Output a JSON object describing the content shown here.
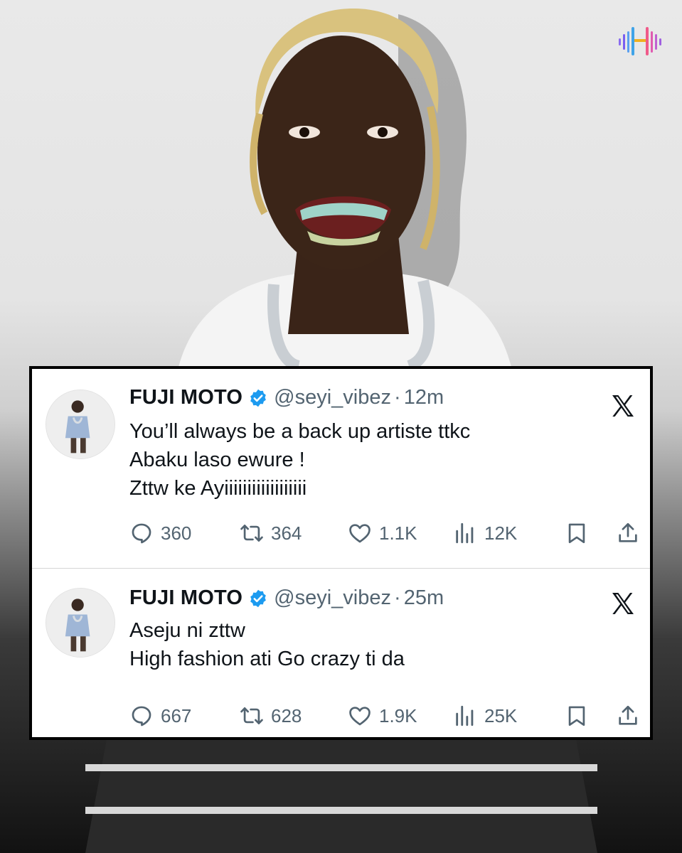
{
  "colors": {
    "card_bg": "#ffffff",
    "card_border": "#000000",
    "name": "#0f1419",
    "meta": "#536471",
    "verified": "#1d9bf0"
  },
  "icons": [
    "brand-logo",
    "verified-badge-icon",
    "x-logo-icon",
    "reply-icon",
    "retweet-icon",
    "like-icon",
    "views-icon",
    "bookmark-icon",
    "share-icon"
  ],
  "tweets": [
    {
      "name": "FUJI MOTO",
      "handle": "@seyi_vibez",
      "separator": "·",
      "time": "12m",
      "lines": [
        "You’ll always be a back up artiste ttkc",
        "Abaku laso ewure !",
        "Zttw ke  Ayiiiiiiiiiiiiiiiiii"
      ],
      "replies": "360",
      "retweets": "364",
      "likes": "1.1K",
      "views": "12K"
    },
    {
      "name": "FUJI MOTO",
      "handle": "@seyi_vibez",
      "separator": "·",
      "time": "25m",
      "lines": [
        "Aseju ni zttw",
        "High fashion ati Go crazy ti da"
      ],
      "replies": "667",
      "retweets": "628",
      "likes": "1.9K",
      "views": "25K"
    }
  ]
}
